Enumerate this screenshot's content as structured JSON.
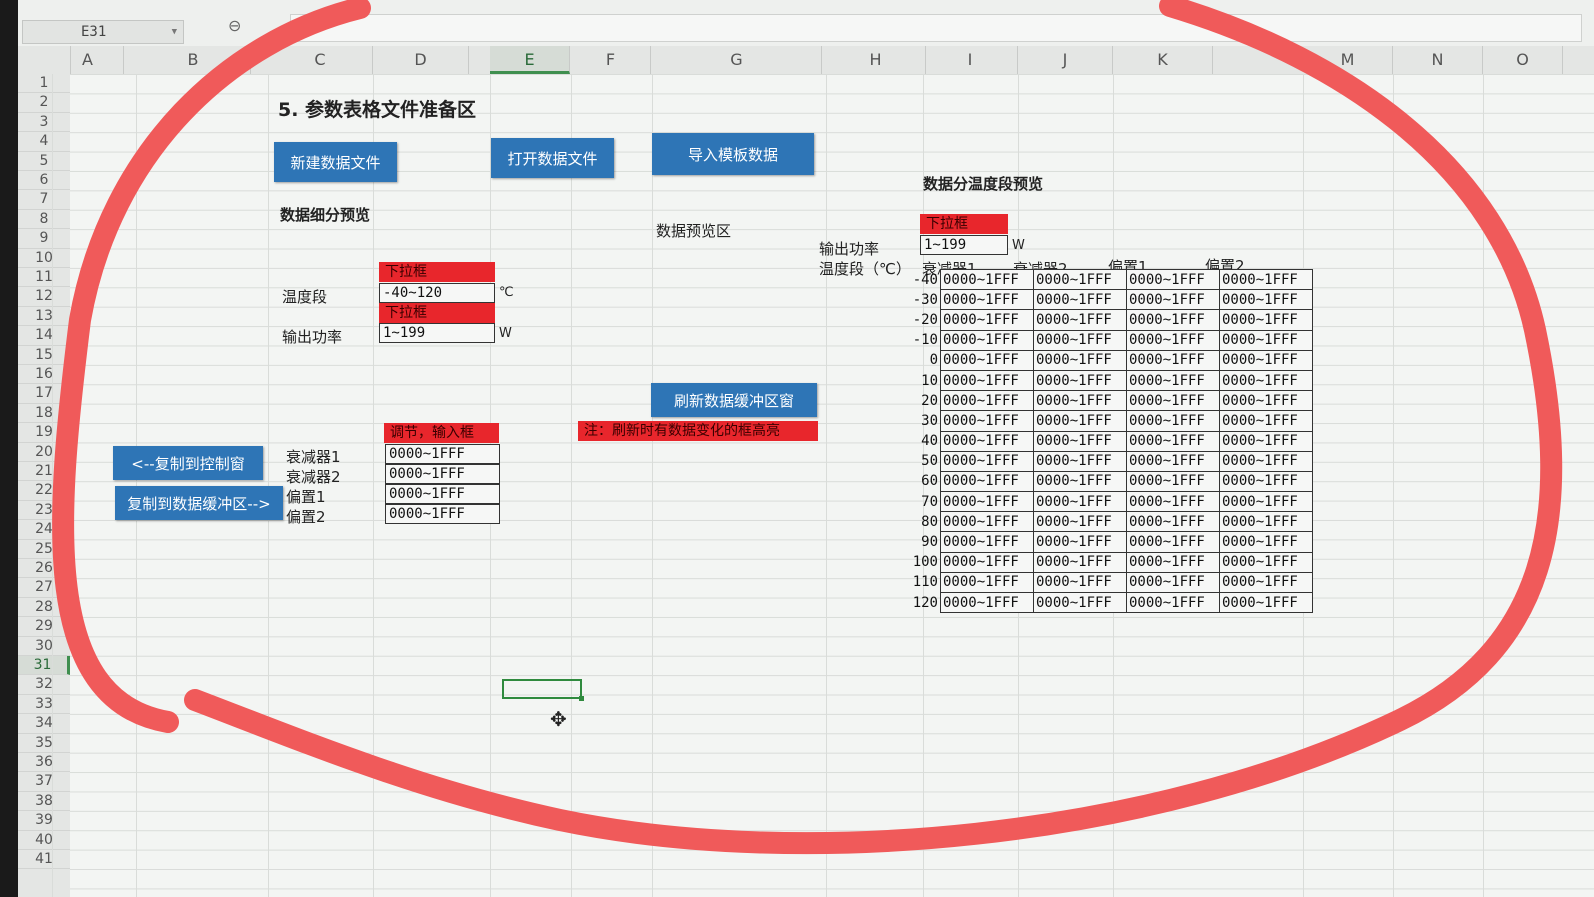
{
  "name_box": "E31",
  "columns": [
    "A",
    "B",
    "C",
    "D",
    "E",
    "F",
    "G",
    "H",
    "I",
    "J",
    "K",
    "M",
    "N",
    "O"
  ],
  "selected_column": "E",
  "rows": [
    "1",
    "2",
    "3",
    "4",
    "5",
    "6",
    "7",
    "8",
    "9",
    "10",
    "11",
    "12",
    "13",
    "14",
    "15",
    "16",
    "17",
    "18",
    "19",
    "20",
    "21",
    "22",
    "23",
    "24",
    "25",
    "26",
    "27",
    "28",
    "29",
    "30",
    "31",
    "32",
    "33",
    "34",
    "35",
    "36",
    "37",
    "38",
    "39",
    "40",
    "41"
  ],
  "selected_row": "31",
  "section_title": "5. 参数表格文件准备区",
  "buttons": {
    "new_file": "新建数据文件",
    "open_file": "打开数据文件",
    "import_template": "导入模板数据",
    "refresh_buffer": "刷新数据缓冲区窗",
    "copy_to_console": "<--复制到控制窗",
    "copy_to_buffer": "复制到数据缓冲区-->"
  },
  "left_panel": {
    "title": "数据细分预览",
    "dropdown_label_1": "下拉框",
    "temp_label": "温度段",
    "temp_value": "-40~120",
    "temp_unit": "℃",
    "dropdown_label_2": "下拉框",
    "power_label": "输出功率",
    "power_value": "1~199",
    "power_unit": "W",
    "adjust_label": "调节，输入框",
    "params": [
      {
        "label": "衰减器1",
        "value": "0000~1FFF"
      },
      {
        "label": "衰减器2",
        "value": "0000~1FFF"
      },
      {
        "label": "偏置1",
        "value": "0000~1FFF"
      },
      {
        "label": "偏置2",
        "value": "0000~1FFF"
      }
    ]
  },
  "middle_panel": {
    "preview_area": "数据预览区",
    "note": "注：刷新时有数据变化的框高亮"
  },
  "right_panel": {
    "title": "数据分温度段预览",
    "dropdown_label": "下拉框",
    "power_label": "输出功率",
    "power_value": "1~199",
    "power_unit": "W",
    "headers": [
      "温度段（℃）",
      "衰减器1",
      "衰减器2",
      "偏置1",
      "偏置2"
    ],
    "temps": [
      "-40",
      "-30",
      "-20",
      "-10",
      "0",
      "10",
      "20",
      "30",
      "40",
      "50",
      "60",
      "70",
      "80",
      "90",
      "100",
      "110",
      "120"
    ],
    "cell_value": "0000~1FFF"
  },
  "colors": {
    "button_blue": "#2e75b6",
    "dropdown_red": "#e8262c",
    "selection_green": "#2f8a3e",
    "annotation_circle": "#f05a5a"
  }
}
